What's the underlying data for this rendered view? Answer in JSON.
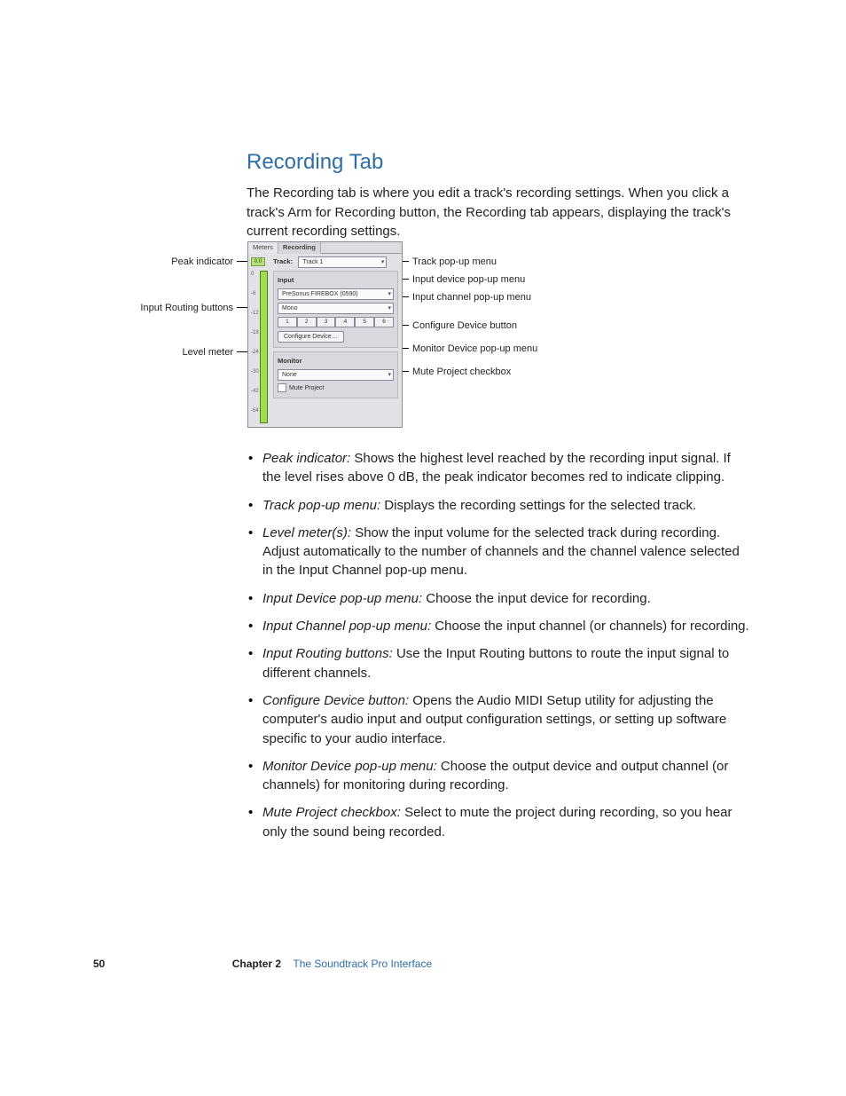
{
  "heading": "Recording Tab",
  "intro": "The Recording tab is where you edit a track's recording settings. When you click a track's Arm for Recording button, the Recording tab appears, displaying the track's current recording settings.",
  "left_callouts": {
    "peak_indicator": "Peak indicator",
    "input_routing_buttons": "Input Routing buttons",
    "level_meter": "Level meter"
  },
  "right_callouts": {
    "track_popup": "Track pop-up menu",
    "input_device_popup": "Input device pop-up menu",
    "input_channel_popup": "Input channel pop-up menu",
    "configure_device_button": "Configure Device button",
    "monitor_device_popup": "Monitor Device pop-up menu",
    "mute_project_checkbox": "Mute Project checkbox"
  },
  "panel": {
    "tab_meters": "Meters",
    "tab_recording": "Recording",
    "peak_value": "0.0",
    "track_label": "Track:",
    "track_value": "Track 1",
    "input_label": "Input",
    "input_device_value": "PreSonus FIREBOX (0590)",
    "input_channel_value": "Mono",
    "routing_values": [
      "1",
      "2",
      "3",
      "4",
      "5",
      "6"
    ],
    "configure_label": "Configure Device…",
    "monitor_label": "Monitor",
    "monitor_value": "None",
    "mute_label": "Mute Project",
    "meter_ticks": [
      "0",
      "-6",
      "-12",
      "-18",
      "-24",
      "-30",
      "-42",
      "-54"
    ]
  },
  "bullets": [
    {
      "term": "Peak indicator:",
      "desc": "  Shows the highest level reached by the recording input signal. If the level rises above 0 dB, the peak indicator becomes red to indicate clipping."
    },
    {
      "term": "Track pop-up menu:",
      "desc": "  Displays the recording settings for the selected track."
    },
    {
      "term": "Level meter(s):",
      "desc": "  Show the input volume for the selected track during recording. Adjust automatically to the number of channels and the channel valence selected in the Input Channel pop-up menu."
    },
    {
      "term": "Input Device pop-up menu:",
      "desc": "  Choose the input device for recording."
    },
    {
      "term": "Input Channel pop-up menu:",
      "desc": "  Choose the input channel (or channels) for recording."
    },
    {
      "term": "Input Routing buttons:",
      "desc": "  Use the Input Routing buttons to route the input signal to different channels."
    },
    {
      "term": "Configure Device button:",
      "desc": "  Opens the Audio MIDI Setup utility for adjusting the computer's audio input and output configuration settings, or setting up software specific to your audio interface."
    },
    {
      "term": "Monitor Device pop-up menu:",
      "desc": "  Choose the output device and output channel (or channels) for monitoring during recording."
    },
    {
      "term": "Mute Project checkbox:",
      "desc": "  Select to mute the project during recording, so you hear only the sound being recorded."
    }
  ],
  "footer": {
    "page_number": "50",
    "chapter_label": "Chapter 2",
    "chapter_title": "The Soundtrack Pro Interface"
  }
}
